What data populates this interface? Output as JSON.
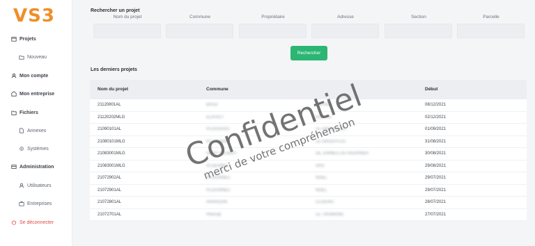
{
  "app": {
    "logo": "VS3"
  },
  "sidebar": {
    "items": [
      {
        "label": "Projets",
        "icon": "calendar-icon"
      },
      {
        "label": "Nouveau",
        "icon": "folder-plus-icon"
      },
      {
        "label": "Mon compte",
        "icon": "user-icon"
      },
      {
        "label": "Mon entreprise",
        "icon": "building-icon"
      },
      {
        "label": "Fichiers",
        "icon": "folder-icon"
      },
      {
        "label": "Annexes",
        "icon": "file-icon"
      },
      {
        "label": "Systèmes",
        "icon": "gear-icon"
      },
      {
        "label": "Administration",
        "icon": "shield-icon"
      },
      {
        "label": "Utilisateurs",
        "icon": "users-icon"
      },
      {
        "label": "Entreprises",
        "icon": "briefcase-icon"
      },
      {
        "label": "Se déconnecter",
        "icon": "power-icon"
      }
    ]
  },
  "search": {
    "title": "Rechercher un projet",
    "fields": [
      {
        "label": "Nom du projet",
        "value": ""
      },
      {
        "label": "Commune",
        "value": ""
      },
      {
        "label": "Propriétaire",
        "value": ""
      },
      {
        "label": "Adresse",
        "value": ""
      },
      {
        "label": "Section",
        "value": ""
      },
      {
        "label": "Parcelle",
        "value": ""
      }
    ],
    "button_label": "Rechercher"
  },
  "recent": {
    "title": "Les derniers projets",
    "columns": [
      "Nom du projet",
      "Commune",
      "",
      "Début"
    ],
    "rows": [
      [
        "21120801AL",
        "BAUD",
        "KERVAL",
        "08/12/2021"
      ],
      [
        "21120202MLG",
        "ILLIFAUT",
        "RUE DU",
        "02/12/2021"
      ],
      [
        "21090101AL",
        "PLOUGRAS",
        "LE GROUFFLIC",
        "01/09/2021"
      ],
      [
        "21080101MLG",
        "PLOUGRAS",
        "LE GROUFFLIC",
        "31/08/2021"
      ],
      [
        "21083001MLG",
        "SAINT-GILBERT",
        "DE JANNES DU HOURNER",
        "30/08/2021"
      ],
      [
        "21083001MLG",
        "PLOERMEL",
        "ARS",
        "29/08/2021"
      ],
      [
        "21072902AL",
        "PLOUHINEC",
        "NOEL",
        "29/07/2021"
      ],
      [
        "21072901AL",
        "PLOUHINEC",
        "NOEL",
        "29/07/2021"
      ],
      [
        "21072801AL",
        "ARRADON",
        "CLOERIC",
        "28/07/2021"
      ],
      [
        "21072701AL",
        "Plescop",
        "LE TROMAINE",
        "27/07/2021"
      ]
    ]
  },
  "watermark": {
    "main": "Confidentiel",
    "sub": "merci de votre compréhension"
  },
  "colors": {
    "logo": "#ef8f27",
    "accent": "#2bb673",
    "danger": "#e04848"
  }
}
